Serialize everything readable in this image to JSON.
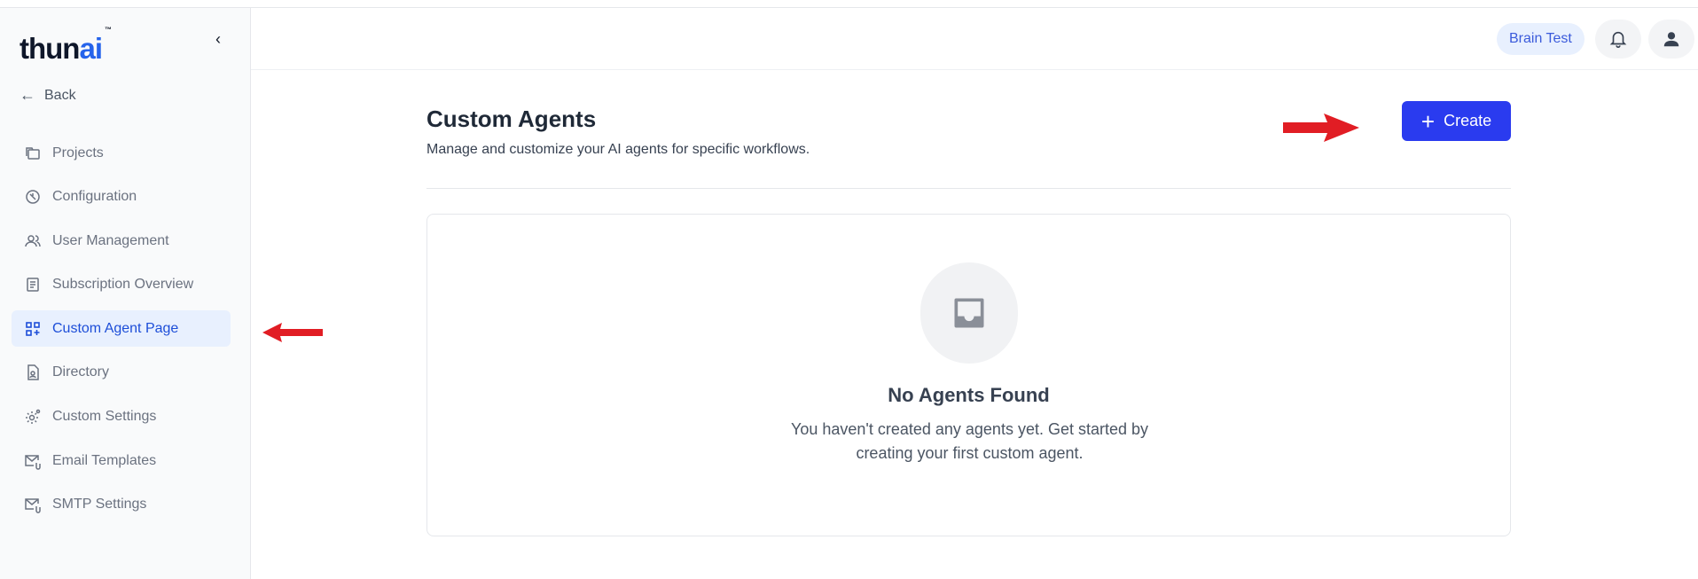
{
  "app": {
    "logo_text_main": "thun",
    "logo_text_accent": "ai",
    "logo_tm": "™"
  },
  "sidebar": {
    "back_label": "Back",
    "items": [
      {
        "label": "Projects",
        "icon": "folders-icon"
      },
      {
        "label": "Configuration",
        "icon": "configuration-icon"
      },
      {
        "label": "User Management",
        "icon": "users-icon"
      },
      {
        "label": "Subscription Overview",
        "icon": "receipt-icon"
      },
      {
        "label": "Custom Agent Page",
        "icon": "grid-add-icon",
        "active": true
      },
      {
        "label": "Directory",
        "icon": "directory-icon"
      },
      {
        "label": "Custom Settings",
        "icon": "settings-gear-icon"
      },
      {
        "label": "Email Templates",
        "icon": "mail-attachment-icon"
      },
      {
        "label": "SMTP Settings",
        "icon": "mail-attachment-icon"
      }
    ]
  },
  "header": {
    "workspace": "Brain Test"
  },
  "main": {
    "title": "Custom Agents",
    "subtitle": "Manage and customize your AI agents for specific workflows.",
    "create_label": "Create",
    "empty_title": "No Agents Found",
    "empty_description": "You haven't created any agents yet. Get started by creating your first custom agent."
  },
  "colors": {
    "accent": "#2a3bef",
    "active_bg": "#e8f0fe",
    "annotation_arrow": "#e11d24"
  }
}
